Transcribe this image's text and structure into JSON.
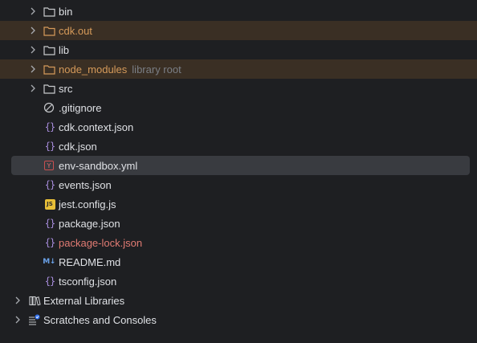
{
  "tree": {
    "folders": [
      {
        "label": "bin"
      },
      {
        "label": "cdk.out"
      },
      {
        "label": "lib"
      },
      {
        "label": "node_modules",
        "hint": "library root"
      },
      {
        "label": "src"
      }
    ],
    "files": [
      {
        "label": ".gitignore"
      },
      {
        "label": "cdk.context.json"
      },
      {
        "label": "cdk.json"
      },
      {
        "label": "env-sandbox.yml"
      },
      {
        "label": "events.json"
      },
      {
        "label": "jest.config.js"
      },
      {
        "label": "package.json"
      },
      {
        "label": "package-lock.json"
      },
      {
        "label": "README.md"
      },
      {
        "label": "tsconfig.json"
      }
    ],
    "roots": [
      {
        "label": "External Libraries"
      },
      {
        "label": "Scratches and Consoles"
      }
    ]
  },
  "colors": {
    "background": "#1e1f22",
    "excluded_row": "#3a2f24",
    "selected_row": "#393b40",
    "excluded_text": "#d59a5a",
    "modified_text": "#e17b73",
    "json_icon": "#a88ddd",
    "js_badge": "#e8bf38"
  },
  "icons": {
    "expand": "chevron-right-icon",
    "folder": "folder-icon",
    "gitignore": "ignore-file-icon",
    "json": "json-braces-icon",
    "yaml": "yaml-file-icon",
    "js": "javascript-file-icon",
    "markdown": "markdown-file-icon",
    "libraries": "library-icon",
    "scratches": "scratches-icon"
  }
}
